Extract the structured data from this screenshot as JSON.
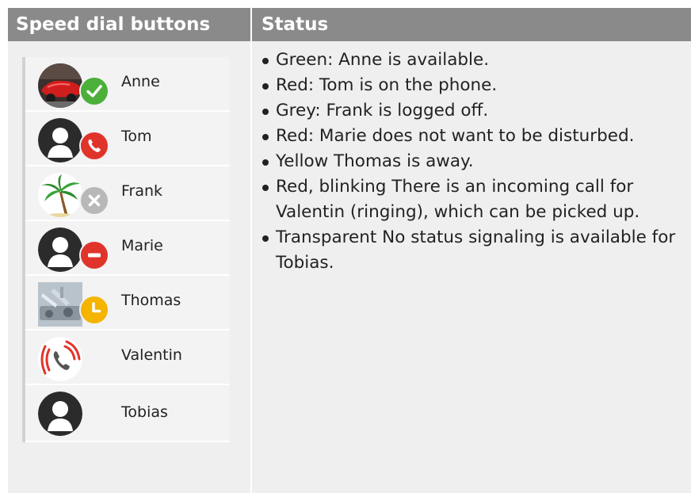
{
  "headers": {
    "left": "Speed dial buttons",
    "right": "Status"
  },
  "contacts": [
    {
      "name": "Anne",
      "avatar": "car-photo",
      "status": "available-check-icon",
      "status_color": "#4caf3a"
    },
    {
      "name": "Tom",
      "avatar": "person-silhouette",
      "status": "phone-icon",
      "status_color": "#e0342b"
    },
    {
      "name": "Frank",
      "avatar": "palm-tree",
      "status": "logged-off-x-icon",
      "status_color": "#b8b8b8"
    },
    {
      "name": "Marie",
      "avatar": "person-silhouette",
      "status": "do-not-disturb-icon",
      "status_color": "#e0342b"
    },
    {
      "name": "Thomas",
      "avatar": "machine-photo",
      "status": "away-clock-icon",
      "status_color": "#f4b400"
    },
    {
      "name": "Valentin",
      "avatar": "ringing-phone",
      "status": "none",
      "status_color": "#e0342b"
    },
    {
      "name": "Tobias",
      "avatar": "person-silhouette",
      "status": "none",
      "status_color": ""
    }
  ],
  "status_items": [
    "Green: Anne is available.",
    "Red: Tom is on the phone.",
    "Grey: Frank is logged off.",
    "Red: Marie does not want to be disturbed.",
    "Yellow Thomas is away.",
    "Red, blinking There is an incoming call for Valentin (ringing), which can be picked up.",
    "Transparent No status signaling is available for Tobias."
  ]
}
